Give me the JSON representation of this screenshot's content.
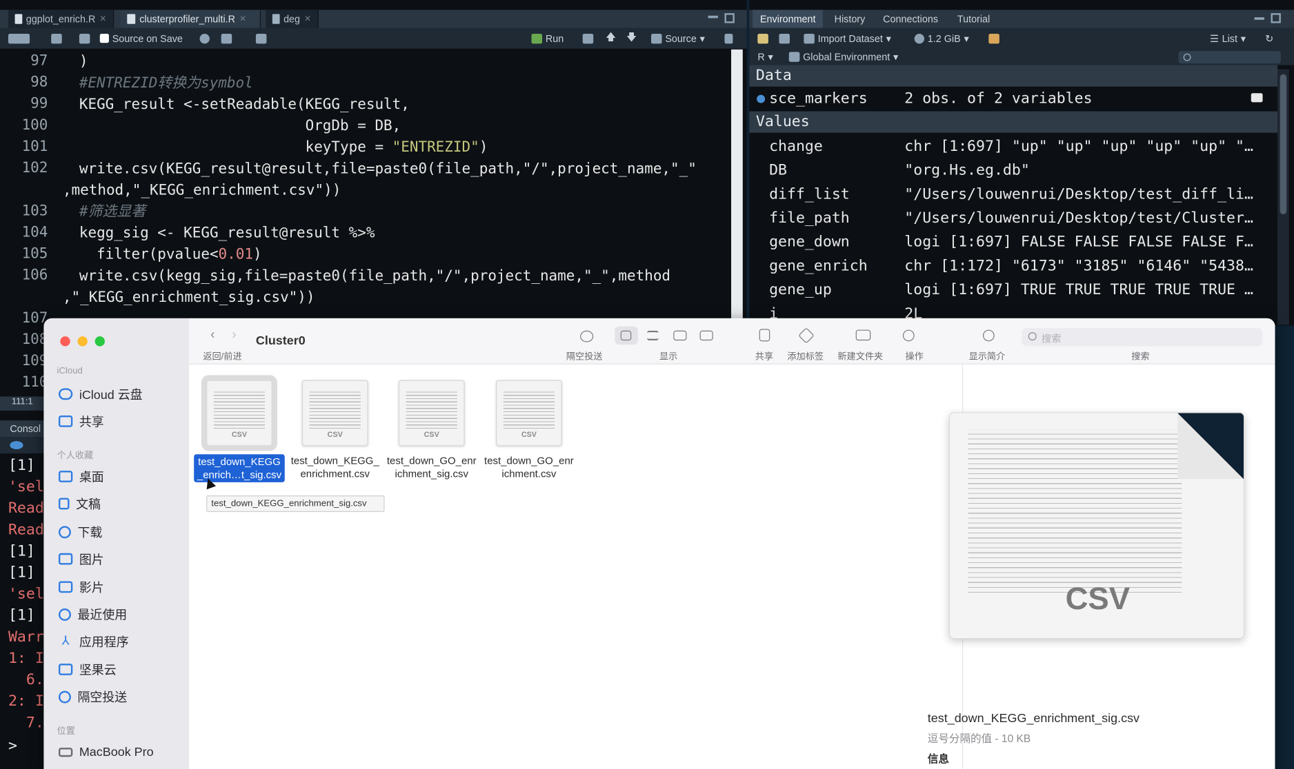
{
  "editor": {
    "tabs": [
      "ggplot_enrich.R",
      "clusterprofiler_multi.R",
      "deg"
    ],
    "toolbar": {
      "source_on_save": "Source on Save",
      "run": "Run",
      "source": "Source"
    },
    "status": "111:1",
    "line_numbers": [
      "97",
      "98",
      "99",
      "100",
      "101",
      "102",
      "103",
      "104",
      "105",
      "106",
      "107",
      "108",
      "109",
      "110"
    ],
    "code": {
      "l97": ")",
      "l98": "#ENTREZID转换为symbol",
      "l99": "KEGG_result <-setReadable(KEGG_result,",
      "l100": "                          OrgDb = DB,",
      "l101a": "                          keyType = ",
      "l101b": "\"ENTREZID\"",
      "l101c": ")",
      "l102": "write.csv(KEGG_result@result,file=paste0(file_path,\"/\",project_name,\"_\"",
      "l102b": ",method,\"_KEGG_enrichment.csv\"))",
      "l103": "#筛选显著",
      "l104": "kegg_sig <- KEGG_result@result %>%",
      "l105a": "  filter(pvalue<",
      "l105b": "0.01",
      "l105c": ")",
      "l106": "write.csv(kegg_sig,file=paste0(file_path,\"/\",project_name,\"_\",method",
      "l106b": ",\"_KEGG_enrichment_sig.csv\"))"
    }
  },
  "console": {
    "title": "Consol",
    "lines": [
      "[1]",
      "'sel",
      "Read",
      "Read",
      "[1]",
      "[1]",
      "'sel",
      "[1]",
      "Warr",
      "1: I",
      "  6.",
      "2: I",
      "  7.",
      ">"
    ]
  },
  "environment": {
    "tabs": [
      "Environment",
      "History",
      "Connections",
      "Tutorial"
    ],
    "toolbar": {
      "import": "Import Dataset",
      "memory": "1.2 GiB",
      "view": "List",
      "lang": "R",
      "scope": "Global Environment"
    },
    "data_header": "Data",
    "data": [
      {
        "name": "sce_markers",
        "value": "2 obs. of 2 variables"
      }
    ],
    "values_header": "Values",
    "values": [
      {
        "name": "change",
        "value": "chr [1:697] \"up\" \"up\" \"up\" \"up\" \"up\" \"…"
      },
      {
        "name": "DB",
        "value": "\"org.Hs.eg.db\""
      },
      {
        "name": "diff_list",
        "value": "\"/Users/louwenrui/Desktop/test_diff_li…"
      },
      {
        "name": "file_path",
        "value": "\"/Users/louwenrui/Desktop/test/Cluster…"
      },
      {
        "name": "gene_down",
        "value": "logi [1:697] FALSE FALSE FALSE FALSE F…"
      },
      {
        "name": "gene_enrich",
        "value": "chr [1:172] \"6173\" \"3185\" \"6146\" \"5438…"
      },
      {
        "name": "gene_up",
        "value": "logi [1:697] TRUE TRUE TRUE TRUE TRUE …"
      },
      {
        "name": "i",
        "value": "2L"
      }
    ]
  },
  "finder": {
    "title": "Cluster0",
    "nav_label": "返回/前进",
    "toolbar": [
      "隔空投送",
      "显示",
      "共享",
      "添加标签",
      "新建文件夹",
      "操作",
      "显示简介",
      "搜索"
    ],
    "search_placeholder": "搜索",
    "sidebar": {
      "icloud_header": "iCloud",
      "icloud": [
        "iCloud 云盘",
        "共享"
      ],
      "favorites_header": "个人收藏",
      "favorites": [
        "桌面",
        "文稿",
        "下载",
        "图片",
        "影片",
        "最近使用",
        "应用程序",
        "坚果云",
        "隔空投送"
      ],
      "locations_header": "位置",
      "locations": [
        "MacBook Pro"
      ]
    },
    "files": [
      {
        "name": "test_down_KEGG_enrich…t_sig.csv",
        "tag": "CSV",
        "selected": true
      },
      {
        "name": "test_down_KEGG_enrichment.csv",
        "tag": "CSV",
        "selected": false
      },
      {
        "name": "test_down_GO_enrichment_sig.csv",
        "tag": "CSV",
        "selected": false
      },
      {
        "name": "test_down_GO_enrichment.csv",
        "tag": "CSV",
        "selected": false
      }
    ],
    "tooltip": "test_down_KEGG_enrichment_sig.csv",
    "preview": {
      "tag": "CSV",
      "name": "test_down_KEGG_enrichment_sig.csv",
      "kind": "逗号分隔的值 - 10 KB",
      "info": "信息"
    }
  }
}
